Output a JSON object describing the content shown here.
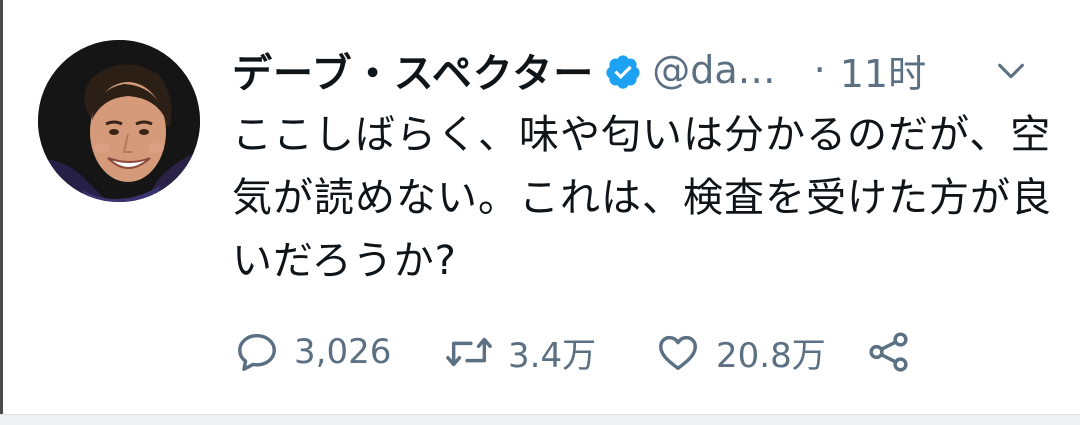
{
  "tweet": {
    "author": {
      "display_name": "デーブ・スペクター",
      "handle": "@da…",
      "verified": true,
      "avatar_icon": "profile-photo"
    },
    "time_separator": "·",
    "timestamp": "11时",
    "more_icon": "chevron-down-icon",
    "text": "ここしばらく、味や匂いは分かるのだが、空気が読めない。これは、検査を受けた方が良いだろうか?",
    "actions": {
      "reply": {
        "icon": "reply-icon",
        "count": "3,026"
      },
      "retweet": {
        "icon": "retweet-icon",
        "count": "3.4万"
      },
      "like": {
        "icon": "heart-icon",
        "count": "20.8万"
      },
      "share": {
        "icon": "share-icon"
      }
    }
  },
  "colors": {
    "text": "#0f1419",
    "muted": "#5b7083",
    "verified": "#1da1f2"
  }
}
